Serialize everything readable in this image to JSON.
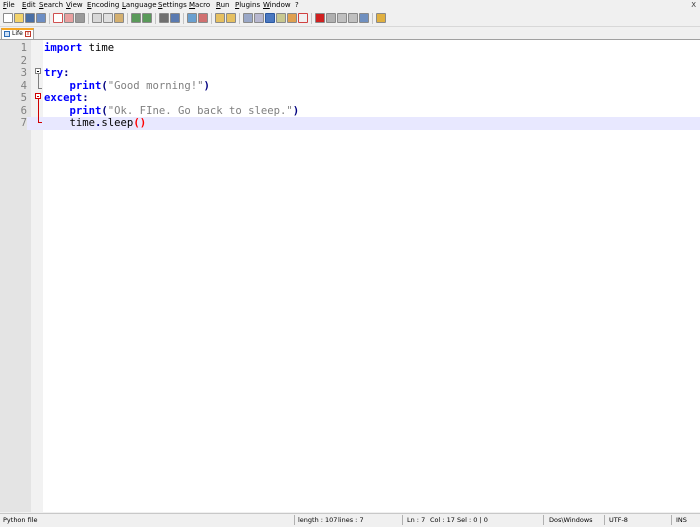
{
  "menubar": {
    "items": [
      "File",
      "Edit",
      "Search",
      "View",
      "Encoding",
      "Language",
      "Settings",
      "Macro",
      "Run",
      "Plugins",
      "Window",
      "?"
    ],
    "close": "X"
  },
  "tabs": [
    {
      "label": "Life",
      "close": "x",
      "active": true
    }
  ],
  "editor": {
    "lines": [
      {
        "number": "1",
        "tokens": [
          [
            "kw",
            "import"
          ],
          [
            "plain",
            " time"
          ]
        ]
      },
      {
        "number": "2",
        "tokens": []
      },
      {
        "number": "3",
        "tokens": [
          [
            "kw",
            "try"
          ],
          [
            "op",
            ":"
          ]
        ]
      },
      {
        "number": "4",
        "tokens": [
          [
            "plain",
            "    "
          ],
          [
            "kw",
            "print"
          ],
          [
            "op",
            "("
          ],
          [
            "str",
            "\"Good morning!\""
          ],
          [
            "op",
            ")"
          ]
        ]
      },
      {
        "number": "5",
        "tokens": [
          [
            "kw",
            "except"
          ],
          [
            "op",
            ":"
          ]
        ]
      },
      {
        "number": "6",
        "tokens": [
          [
            "plain",
            "    "
          ],
          [
            "kw",
            "print"
          ],
          [
            "op",
            "("
          ],
          [
            "str",
            "\"Ok. FIne. Go back to sleep.\""
          ],
          [
            "op",
            ")"
          ]
        ]
      },
      {
        "number": "7",
        "tokens": [
          [
            "plain",
            "    time"
          ],
          [
            "op",
            "."
          ],
          [
            "plain",
            "sleep"
          ],
          [
            "paren-hl",
            "()"
          ]
        ]
      }
    ],
    "current_line": "7"
  },
  "statusbar": {
    "file_type": "Python file",
    "length": "length : 107",
    "lines": "lines : 7",
    "ln": "Ln : 7",
    "col": "Col : 17",
    "sel": "Sel : 0 | 0",
    "eol": "Dos\\Windows",
    "encoding": "UTF-8",
    "mode": "INS"
  },
  "colors": {
    "keyword": "#0000ff",
    "string": "#808080",
    "operator": "#000080",
    "brace_match": "#ff0000",
    "current_line": "#e8e8ff",
    "tab_accent": "#f5a623"
  }
}
